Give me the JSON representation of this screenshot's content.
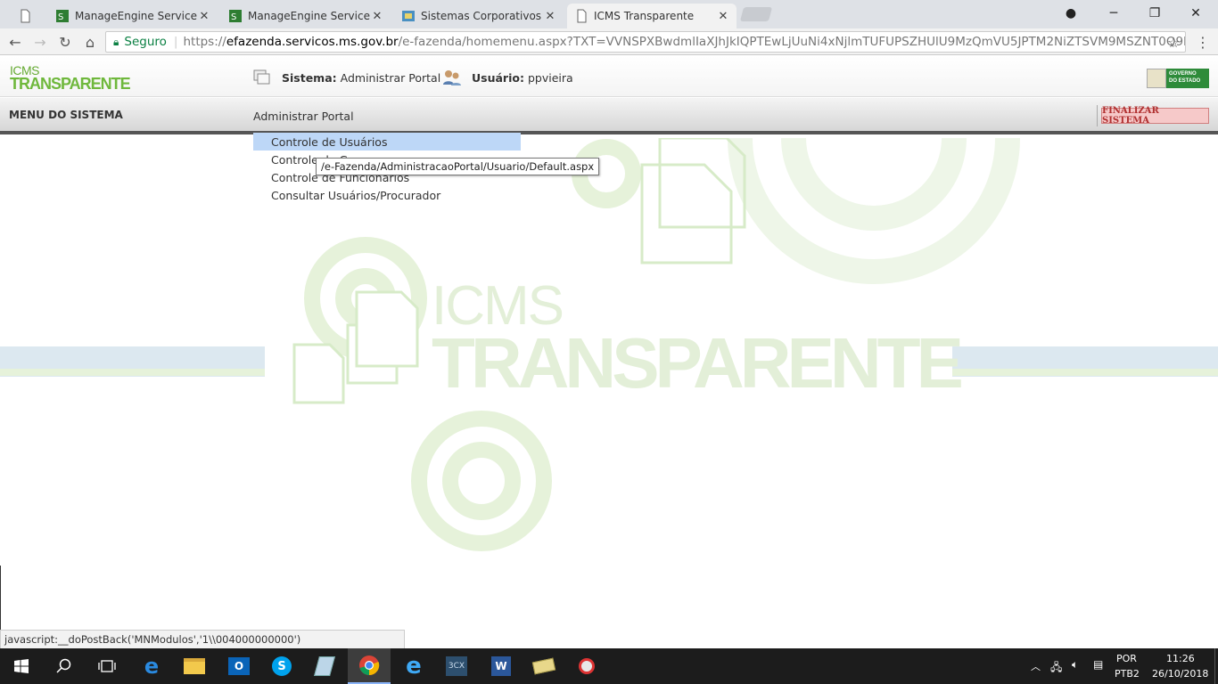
{
  "browser": {
    "tabs": [
      {
        "title": "",
        "icon": "page-icon"
      },
      {
        "title": "ManageEngine ServiceDe",
        "icon": "manageengine-icon"
      },
      {
        "title": "ManageEngine ServiceDe",
        "icon": "manageengine-icon"
      },
      {
        "title": "Sistemas Corporativos - ",
        "icon": "corporate-icon"
      },
      {
        "title": "ICMS Transparente",
        "icon": "page-icon",
        "active": true
      }
    ],
    "omnibox": {
      "secure_label": "Seguro",
      "url_scheme": "https://",
      "url_host": "efazenda.servicos.ms.gov.br",
      "url_path": "/e-fazenda/homemenu.aspx?TXT=VVNSPXBwdmlIaXJhJkIQPTEwLjUuNi4xNjlmTUFUPSZHUlU9MzQmVU5JPTM2NiZTSVM9MSZNT0Q9LTEmT..."
    }
  },
  "header": {
    "logo_top": "ICMS",
    "logo_bottom": "TRANSPARENTE",
    "sistema_label": "Sistema:",
    "sistema_value": "Administrar Portal",
    "usuario_label": "Usuário:",
    "usuario_value": "ppvieira",
    "gov_logo_line1": "GOVERNO",
    "gov_logo_line2": "DO ESTADO"
  },
  "menu": {
    "title": "MENU DO SISTEMA",
    "top_item": "Administrar Portal",
    "finalizar_label": "FINALIZAR SISTEMA",
    "dropdown": [
      {
        "label": "Controle de Usuários",
        "hover": true
      },
      {
        "label": "Controle de G"
      },
      {
        "label": "Controle de Funcionários"
      },
      {
        "label": "Consultar Usuários/Procurador"
      }
    ],
    "tooltip": "/e-Fazenda/AdministracaoPortal/Usuario/Default.aspx"
  },
  "watermark": {
    "line1": "ICMS",
    "line2": "TRANSPARENTE"
  },
  "status_bar": "javascript:__doPostBack('MNModulos','1\\\\004000000000')",
  "taskbar": {
    "language": "POR",
    "layout": "PTB2",
    "time": "11:26",
    "date": "26/10/2018"
  },
  "colors": {
    "brand_green": "#6fb83c",
    "menu_hover": "#bdd7f7",
    "finalizar_bg": "#f6c9c9",
    "finalizar_text": "#b03030",
    "watermark_band": "#dce8f0"
  }
}
